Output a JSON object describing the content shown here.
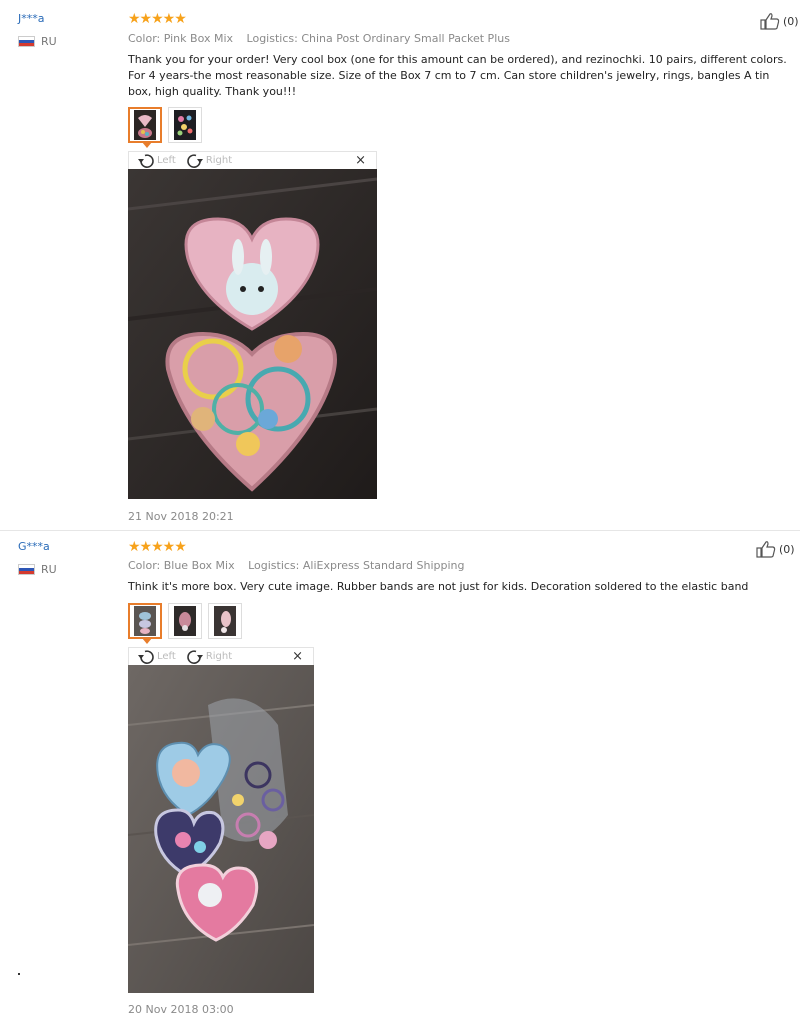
{
  "reviews": [
    {
      "buyer": "J***a",
      "country": "RU",
      "stars": "★★★★★",
      "color_label": "Color:",
      "color_value": "Pink Box Mix",
      "logistics_label": "Logistics:",
      "logistics_value": "China Post Ordinary Small Packet Plus",
      "text": "Thank you for your order! Very cool box (one for this amount can be ordered), and rezinochki. 10 pairs, different colors. For 4 years-the most reasonable size. Size of the Box 7 cm to 7 cm. Can store children's jewelry, rings, bangles A tin box, high quality. Thank you!!!",
      "helpful": "(0)",
      "rotate_left": "Left",
      "rotate_right": "Right",
      "close": "×",
      "date": "21 Nov 2018 20:21"
    },
    {
      "buyer": "G***a",
      "country": "RU",
      "stars": "★★★★★",
      "color_label": "Color:",
      "color_value": "Blue Box Mix",
      "logistics_label": "Logistics:",
      "logistics_value": "AliExpress Standard Shipping",
      "text": "Think it's more box. Very cute image. Rubber bands are not just for kids. Decoration soldered to the elastic band",
      "helpful": "(0)",
      "rotate_left": "Left",
      "rotate_right": "Right",
      "close": "×",
      "date": "20 Nov 2018 03:00"
    }
  ],
  "colors": {
    "star": "#f7a21b",
    "buyer_link": "#2a6bb8",
    "active_thumb": "#e87d2b"
  },
  "icons": [
    "thumbs-up-icon",
    "rotate-left-icon",
    "rotate-right-icon",
    "close-icon",
    "russia-flag-icon",
    "star-icon"
  ]
}
